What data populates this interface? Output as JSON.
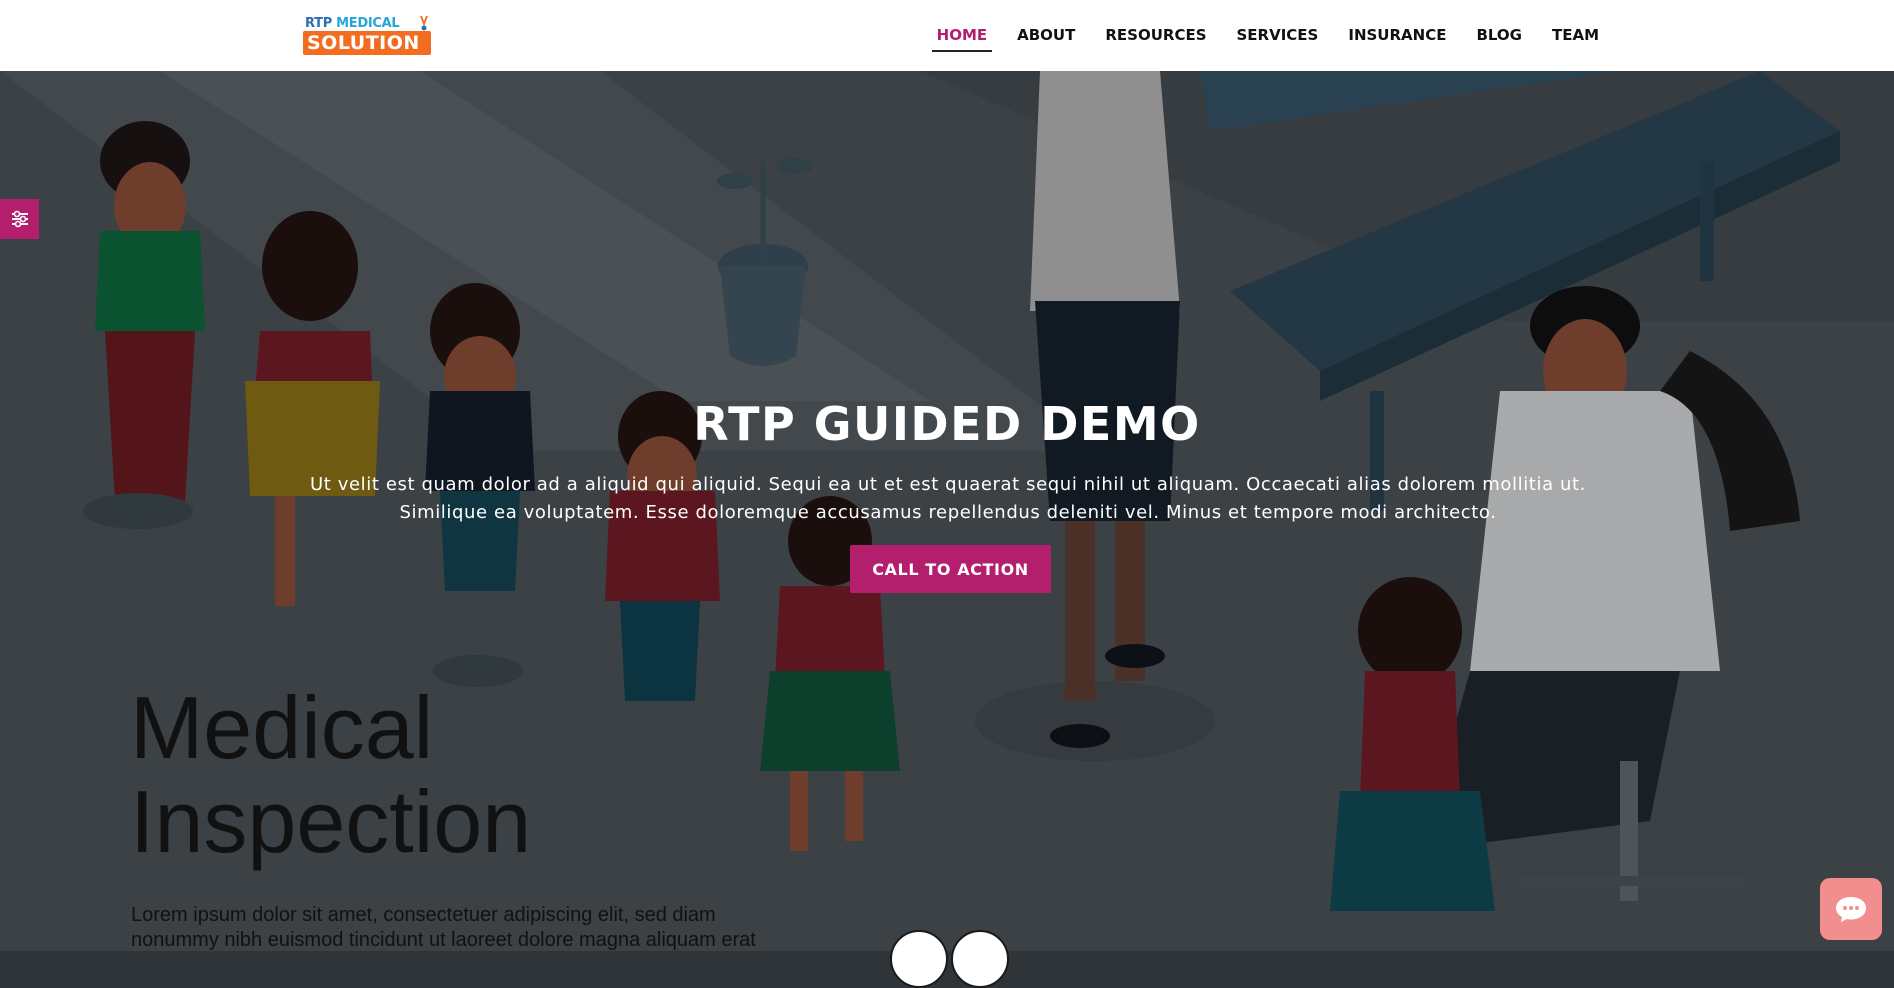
{
  "brand": {
    "logo_line1_a": "RTP ",
    "logo_line1_b": "MEDICAL",
    "logo_line2": "SOLUTION",
    "colors": {
      "orange": "#f36d21",
      "blue": "#2b6fb3"
    }
  },
  "nav": {
    "items": [
      {
        "label": "HOME",
        "active": true
      },
      {
        "label": "ABOUT"
      },
      {
        "label": "RESOURCES"
      },
      {
        "label": "SERVICES"
      },
      {
        "label": "INSURANCE"
      },
      {
        "label": "BLOG"
      },
      {
        "label": "TEAM"
      }
    ],
    "active_color": "#b01f6d"
  },
  "hero": {
    "title": "RTP GUIDED DEMO",
    "text": "Ut velit est quam dolor ad a aliquid qui aliquid. Sequi ea ut et est quaerat sequi nihil ut aliquam. Occaecati alias dolorem mollitia ut. Similique ea voluptatem. Esse doloremque accusamus repellendus deleniti vel. Minus et tempore modi architecto.",
    "cta_label": "CALL TO ACTION",
    "cta_color": "#b31f6d"
  },
  "poster": {
    "title_line1": "Medical",
    "title_line2": "Inspection",
    "text": "Lorem ipsum dolor sit amet, consectetuer adipiscing elit, sed diam nonummy nibh euismod tincidunt ut laoreet dolore magna aliquam erat volutpat. Ut wisi enim ad minim veniam, quis nostrud exerci tation"
  },
  "widgets": {
    "side_tab_icon": "sliders-icon",
    "chat_icon": "chat-bubble-icon",
    "chat_color": "#f38e8e"
  }
}
